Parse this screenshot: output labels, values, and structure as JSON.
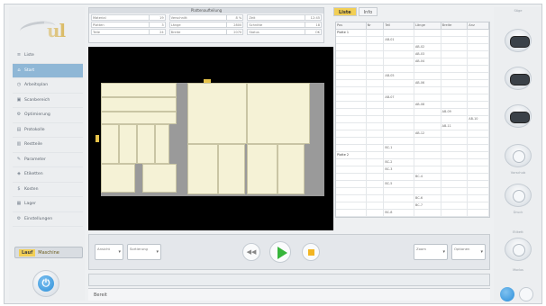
{
  "sidebar": {
    "items": [
      {
        "label": "Liste",
        "icon": "list-icon"
      },
      {
        "label": "Start",
        "icon": "home-icon"
      },
      {
        "label": "Arbeitsplan",
        "icon": "clock-icon"
      },
      {
        "label": "Scanbereich",
        "icon": "scan-icon"
      },
      {
        "label": "Optimierung",
        "icon": "optimize-icon"
      },
      {
        "label": "Protokolle",
        "icon": "log-icon"
      },
      {
        "label": "Restteile",
        "icon": "parts-icon"
      },
      {
        "label": "Parameter",
        "icon": "wrench-icon"
      },
      {
        "label": "Etiketten",
        "icon": "label-icon"
      },
      {
        "label": "Kosten",
        "icon": "cost-icon"
      },
      {
        "label": "Lager",
        "icon": "stock-icon"
      },
      {
        "label": "Einstellungen",
        "icon": "settings-icon"
      }
    ],
    "active_index": 1,
    "selector_label": "Maschine",
    "selector_value": "Lauf"
  },
  "topbar": {
    "caption": "Plattenaufteilung",
    "columns": [
      [
        {
          "k": "Material",
          "v": "19"
        },
        {
          "k": "Platten",
          "v": "3"
        },
        {
          "k": "Teile",
          "v": "24"
        }
      ],
      [
        {
          "k": "Verschnitt",
          "v": "8 %"
        },
        {
          "k": "Länge",
          "v": "2800"
        },
        {
          "k": "Breite",
          "v": "2070"
        }
      ],
      [
        {
          "k": "Zeit",
          "v": "12:45"
        },
        {
          "k": "Schnitte",
          "v": "18"
        },
        {
          "k": "Status",
          "v": "OK"
        }
      ]
    ]
  },
  "tabs": [
    {
      "label": "Liste",
      "active": true
    },
    {
      "label": "Info",
      "active": false
    }
  ],
  "rtable": {
    "headers": [
      "Pos",
      "Nr",
      "Teil",
      "Länge",
      "Breite",
      "Anz"
    ],
    "rows": [
      [
        "Platte 1",
        "",
        "",
        "",
        "",
        ""
      ],
      [
        "",
        "",
        "AB-01",
        "",
        "",
        ""
      ],
      [
        "",
        "",
        "",
        "AB-02",
        "",
        ""
      ],
      [
        "",
        "",
        "",
        "AB-03",
        "",
        ""
      ],
      [
        "",
        "",
        "",
        "AB-04",
        "",
        ""
      ],
      [
        "",
        "",
        "",
        "",
        "",
        ""
      ],
      [
        "",
        "",
        "AB-05",
        "",
        "",
        ""
      ],
      [
        "",
        "",
        "",
        "AB-06",
        "",
        ""
      ],
      [
        "",
        "",
        "",
        "",
        "",
        ""
      ],
      [
        "",
        "",
        "AB-07",
        "",
        "",
        ""
      ],
      [
        "",
        "",
        "",
        "AB-08",
        "",
        ""
      ],
      [
        "",
        "",
        "",
        "",
        "AB-09",
        ""
      ],
      [
        "",
        "",
        "",
        "",
        "",
        "AB-10"
      ],
      [
        "",
        "",
        "",
        "",
        "AB-11",
        ""
      ],
      [
        "",
        "",
        "",
        "AB-12",
        "",
        ""
      ],
      [
        "",
        "",
        "",
        "",
        "",
        ""
      ],
      [
        "",
        "",
        "BC-1",
        "",
        "",
        ""
      ],
      [
        "Platte 2",
        "",
        "",
        "",
        "",
        ""
      ],
      [
        "",
        "",
        "BC-2",
        "",
        "",
        ""
      ],
      [
        "",
        "",
        "BC-3",
        "",
        "",
        ""
      ],
      [
        "",
        "",
        "",
        "BC-4",
        "",
        ""
      ],
      [
        "",
        "",
        "BC-5",
        "",
        "",
        ""
      ],
      [
        "",
        "",
        "",
        "",
        "",
        ""
      ],
      [
        "",
        "",
        "",
        "BC-6",
        "",
        ""
      ],
      [
        "",
        "",
        "",
        "BC-7",
        "",
        ""
      ],
      [
        "",
        "",
        "BC-8",
        "",
        "",
        ""
      ],
      [
        "Platte 3",
        "",
        "",
        "",
        "",
        ""
      ]
    ]
  },
  "controls": {
    "left_dropdown_1": "Ansicht",
    "left_dropdown_2": "Sortierung",
    "right_dropdown_1": "Zoom",
    "right_dropdown_2": "Optionen"
  },
  "status_text": "Bereit",
  "tools": {
    "captions": [
      "Säge",
      "",
      "",
      "Vorschub",
      "Druck",
      "Etikett",
      "Modus"
    ]
  }
}
